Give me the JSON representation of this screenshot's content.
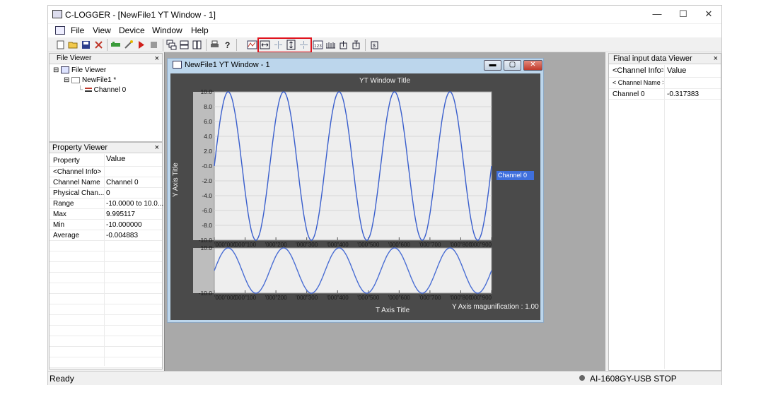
{
  "app": {
    "title": "C-LOGGER - [NewFile1 YT Window - 1]",
    "minimize": "—",
    "maximize": "☐",
    "close": "✕"
  },
  "menu": [
    "File",
    "View",
    "Device",
    "Window",
    "Help"
  ],
  "file_viewer": {
    "header": "File Viewer",
    "close": "×",
    "root": "File Viewer",
    "file": "NewFile1 *",
    "channel": "Channel 0"
  },
  "property_viewer": {
    "header": "Property Viewer",
    "close": "×",
    "col_property": "Property",
    "col_value": "Value",
    "rows": [
      {
        "k": "<Channel Info>",
        "v": ""
      },
      {
        "k": "Channel Name",
        "v": "Channel 0"
      },
      {
        "k": "Physical Chan...",
        "v": "0"
      },
      {
        "k": "Range",
        "v": "-10.0000 to 10.0..."
      },
      {
        "k": "Max",
        "v": "9.995117"
      },
      {
        "k": "Min",
        "v": "-10.000000"
      },
      {
        "k": "Average",
        "v": "-0.004883"
      }
    ]
  },
  "final_viewer": {
    "header": "Final input data Viewer",
    "close": "×",
    "col1": "<Channel Info>",
    "col2": "Value",
    "sub": "< Channel Name >",
    "rows": [
      {
        "k": "Channel 0",
        "v": "-0.317383"
      }
    ]
  },
  "yt_window": {
    "title": "NewFile1 YT Window - 1",
    "btn_min": "▬",
    "btn_max": "▢",
    "btn_close": "✕",
    "chart_title": "YT Window Title",
    "y_axis_title": "Y Axis Title",
    "t_axis_title": "T Axis Title",
    "magnification": "Y Axis magunification : 1.00",
    "legend": "Channel 0"
  },
  "status": {
    "left": "Ready",
    "right": "AI-1608GY-USB STOP"
  },
  "chart_data": [
    {
      "type": "line",
      "title": "YT Window Title",
      "ylabel": "Y Axis Title",
      "xlabel": "T Axis Title",
      "ylim": [
        -10.0,
        10.0
      ],
      "y_ticks": [
        "10.0",
        "8.0",
        "6.0",
        "4.0",
        "2.0",
        "-0.0",
        "-2.0",
        "-4.0",
        "-6.0",
        "-8.0",
        "-10.0"
      ],
      "x_ticks": [
        "'000\"000",
        "'000\"100",
        "'000\"200",
        "'000\"300",
        "'000\"400",
        "'000\"500",
        "'000\"600",
        "'000\"700",
        "'000\"800",
        "'000\"900"
      ],
      "series": [
        {
          "name": "Channel 0",
          "color": "#3a5fcd",
          "waveform": "sine",
          "amplitude": 10.0,
          "cycles": 5,
          "start_value": 0.0
        }
      ]
    },
    {
      "type": "line",
      "ylim": [
        -10.0,
        10.0
      ],
      "y_ticks": [
        "10.0",
        "-10.0"
      ],
      "x_ticks": [
        "'000\"000",
        "'000\"100",
        "'000\"200",
        "'000\"300",
        "'000\"400",
        "'000\"500",
        "'000\"600",
        "'000\"700",
        "'000\"800",
        "'000\"900"
      ],
      "series": [
        {
          "color": "#4a6ed4",
          "waveform": "sine",
          "amplitude": 10.0,
          "cycles": 5,
          "start_value": 0.0
        }
      ]
    }
  ]
}
